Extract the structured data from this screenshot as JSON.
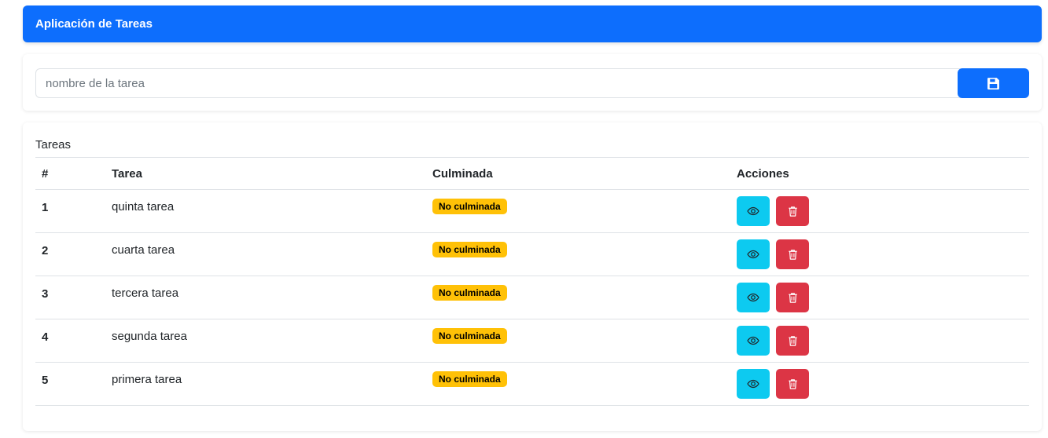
{
  "header": {
    "title": "Aplicación de Tareas"
  },
  "form": {
    "input_placeholder": "nombre de la tarea",
    "input_value": "",
    "save_icon": "floppy-disk-icon"
  },
  "list": {
    "title": "Tareas",
    "columns": [
      "#",
      "Tarea",
      "Culminada",
      "Acciones"
    ],
    "rows": [
      {
        "num": "1",
        "name": "quinta tarea",
        "status": "No culminada"
      },
      {
        "num": "2",
        "name": "cuarta tarea",
        "status": "No culminada"
      },
      {
        "num": "3",
        "name": "tercera tarea",
        "status": "No culminada"
      },
      {
        "num": "4",
        "name": "segunda tarea",
        "status": "No culminada"
      },
      {
        "num": "5",
        "name": "primera tarea",
        "status": "No culminada"
      }
    ],
    "actions": {
      "view_icon": "eye-icon",
      "delete_icon": "trash-icon"
    }
  },
  "colors": {
    "primary": "#0d6efd",
    "info": "#0dcaf0",
    "danger": "#dc3545",
    "warning": "#ffc107"
  }
}
